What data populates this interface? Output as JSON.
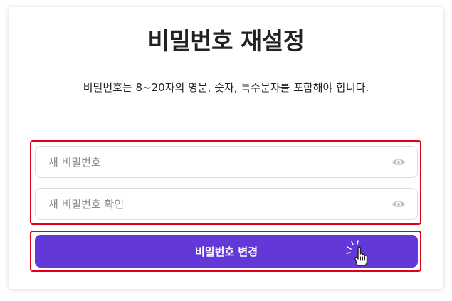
{
  "page": {
    "title": "비밀번호 재설정",
    "description": "비밀번호는 8~20자의 영문, 숫자, 특수문자를 포함해야 합니다."
  },
  "form": {
    "new_password": {
      "value": "",
      "placeholder": "새 비밀번호",
      "toggle_icon": "eye-icon"
    },
    "confirm_password": {
      "value": "",
      "placeholder": "새 비밀번호 확인",
      "toggle_icon": "eye-icon"
    },
    "submit_label": "비밀번호 변경"
  },
  "colors": {
    "accent": "#6238d8",
    "highlight": "#e0001b",
    "icon": "#c4c4c4"
  }
}
